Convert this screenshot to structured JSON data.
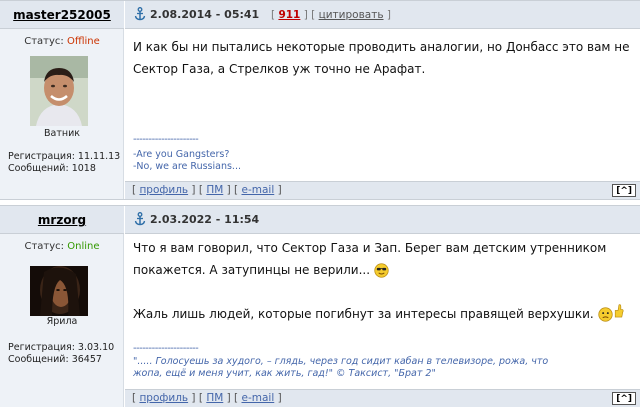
{
  "posts": [
    {
      "author": "master252005",
      "status_label": "Статус:",
      "status_value": "Offline",
      "rank": "Ватник",
      "reg_label": "Регистрация: 11.11.13",
      "msgs_label": "Сообщений: 1018",
      "date": "2.08.2014 - 05:41",
      "post_number": "911",
      "cite_label": "цитировать",
      "text": "И как бы ни пытались некоторые проводить аналогии, но Донбасс это вам не Сектор Газа, а Стрелков уж точно не Арафат.",
      "sig_line": "---------------------",
      "sig_1": "-Are you Gangsters?",
      "sig_2": "-No, we are Russians...",
      "profile": "профиль",
      "pm": "ПМ",
      "email": "e-mail",
      "totop": "[^]"
    },
    {
      "author": "mrzorg",
      "status_label": "Статус:",
      "status_value": "Online",
      "rank": "Ярила",
      "reg_label": "Регистрация: 3.03.10",
      "msgs_label": "Сообщений: 36457",
      "date": "2.03.2022 - 11:54",
      "text_1": "Что я вам говорил, что Сектор Газа и Зап. Берег вам детским утренником покажется. А затупинцы не верили...",
      "text_2": "Жаль лишь людей, которые погибнут за интересы правящей верхушки.",
      "sig_line": "---------------------",
      "sig_quote": "\"..... Голосуешь за худого, – глядь, через год сидит кабан в телевизоре, рожа, что жопа, ещё и меня учит, как жить, гад!\" © Таксист, \"Брат 2\"",
      "profile": "профиль",
      "pm": "ПМ",
      "email": "e-mail",
      "totop": "[^]"
    }
  ],
  "colors": {
    "header_bg": "#e1e7ef",
    "author_bg": "#eef2f7",
    "offline": "#cc3300",
    "online": "#339900",
    "post_number": "#c00000",
    "link": "#4466aa"
  },
  "icons": [
    "anchor-icon",
    "cool-smile-icon",
    "sad-smile-icon",
    "thumbs-up-icon"
  ]
}
